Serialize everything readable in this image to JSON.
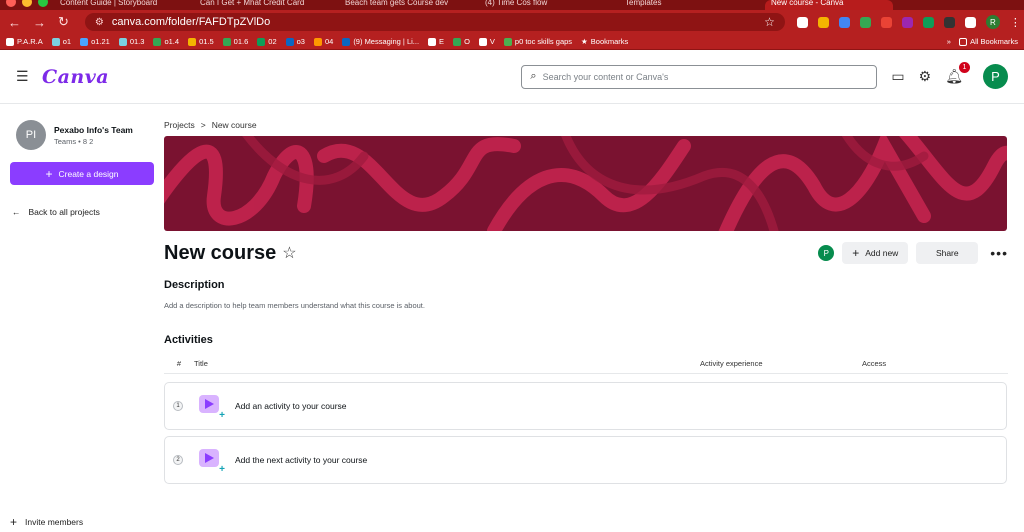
{
  "browser": {
    "tabs": [
      {
        "label": "Content Guide | Storyboard",
        "active": false
      },
      {
        "label": "Can I Get + Mhat Credit Card",
        "active": false
      },
      {
        "label": "Beach team gets Course dev",
        "active": false
      },
      {
        "label": "(4) Time Cos flow",
        "active": false
      },
      {
        "label": "Templates",
        "active": false
      },
      {
        "label": "New course - Canva",
        "active": true
      }
    ],
    "url": "canva.com/folder/FAFDTpZVlDo",
    "bookmarks": [
      "P.A.R.A",
      "o1",
      "o1.21",
      "01.3",
      "o1.4",
      "01.5",
      "01.6",
      "02",
      "o3",
      "04",
      "(9) Messaging | Li...",
      "E",
      "O",
      "V",
      "p0 toc skills gaps",
      "Bookmarks"
    ],
    "all_bookmarks": "All Bookmarks",
    "profile_initial": "R"
  },
  "header": {
    "logo": "Canva",
    "search_placeholder": "Search your content or Canva's",
    "notification_count": "1",
    "user_initial": "P"
  },
  "sidebar": {
    "team_initials": "PI",
    "team_name": "Pexabo Info's Team",
    "team_meta": "Teams • 8 2",
    "create_label": "Create a design",
    "back_label": "Back to all projects",
    "invite_label": "Invite members"
  },
  "content": {
    "breadcrumb": {
      "root": "Projects",
      "separator": ">",
      "current": "New course"
    },
    "title": "New course",
    "owner_initial": "P",
    "add_new_label": "Add new",
    "share_label": "Share",
    "description_heading": "Description",
    "description_text": "Add a description to help team members understand what this course is about.",
    "activities_heading": "Activities",
    "columns": {
      "num": "#",
      "title": "Title",
      "experience": "Activity experience",
      "access": "Access"
    },
    "activities": [
      {
        "num": "1",
        "label": "Add an activity to your course"
      },
      {
        "num": "2",
        "label": "Add the next activity to your course"
      }
    ]
  },
  "colors": {
    "brand_purple": "#8b3dff",
    "banner_base": "#7a1230",
    "banner_stroke": "#c4254f",
    "browser_red": "#b52020",
    "avatar_green": "#078c4e"
  }
}
